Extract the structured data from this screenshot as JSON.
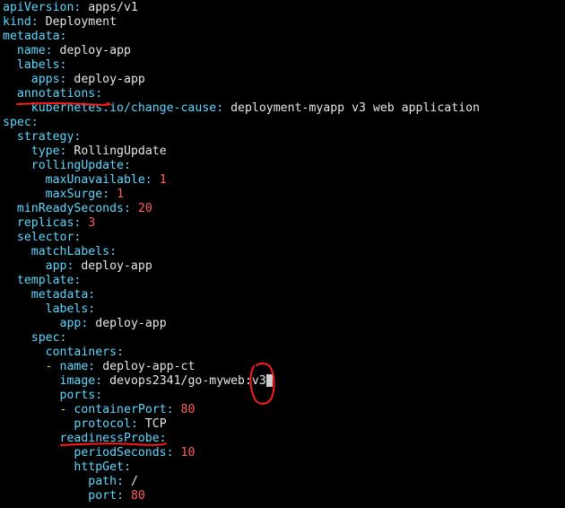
{
  "lines": [
    {
      "indent": "",
      "key": "apiVersion",
      "sep": ": ",
      "value": "apps/v1",
      "vtype": "s"
    },
    {
      "indent": "",
      "key": "kind",
      "sep": ": ",
      "value": "Deployment",
      "vtype": "s"
    },
    {
      "indent": "",
      "key": "metadata",
      "sep": ":",
      "value": "",
      "vtype": "s"
    },
    {
      "indent": "  ",
      "key": "name",
      "sep": ": ",
      "value": "deploy-app",
      "vtype": "s"
    },
    {
      "indent": "  ",
      "key": "labels",
      "sep": ":",
      "value": "",
      "vtype": "s"
    },
    {
      "indent": "    ",
      "key": "apps",
      "sep": ": ",
      "value": "deploy-app",
      "vtype": "s"
    },
    {
      "indent": "  ",
      "key": "annotations",
      "sep": ":",
      "value": "",
      "vtype": "s"
    },
    {
      "indent": "    ",
      "key": "kubernetes.io/change-cause",
      "sep": ": ",
      "value": "deployment-myapp v3 web application",
      "vtype": "s"
    },
    {
      "indent": "",
      "key": "spec",
      "sep": ":",
      "value": "",
      "vtype": "s"
    },
    {
      "indent": "  ",
      "key": "strategy",
      "sep": ":",
      "value": "",
      "vtype": "s"
    },
    {
      "indent": "    ",
      "key": "type",
      "sep": ": ",
      "value": "RollingUpdate",
      "vtype": "s"
    },
    {
      "indent": "    ",
      "key": "rollingUpdate",
      "sep": ":",
      "value": "",
      "vtype": "s"
    },
    {
      "indent": "      ",
      "key": "maxUnavailable",
      "sep": ": ",
      "value": "1",
      "vtype": "n"
    },
    {
      "indent": "      ",
      "key": "maxSurge",
      "sep": ": ",
      "value": "1",
      "vtype": "n"
    },
    {
      "indent": "  ",
      "key": "minReadySeconds",
      "sep": ": ",
      "value": "20",
      "vtype": "n"
    },
    {
      "indent": "  ",
      "key": "replicas",
      "sep": ": ",
      "value": "3",
      "vtype": "n"
    },
    {
      "indent": "  ",
      "key": "selector",
      "sep": ":",
      "value": "",
      "vtype": "s"
    },
    {
      "indent": "    ",
      "key": "matchLabels",
      "sep": ":",
      "value": "",
      "vtype": "s"
    },
    {
      "indent": "      ",
      "key": "app",
      "sep": ": ",
      "value": "deploy-app",
      "vtype": "s"
    },
    {
      "indent": "  ",
      "key": "template",
      "sep": ":",
      "value": "",
      "vtype": "s"
    },
    {
      "indent": "    ",
      "key": "metadata",
      "sep": ":",
      "value": "",
      "vtype": "s"
    },
    {
      "indent": "      ",
      "key": "labels",
      "sep": ":",
      "value": "",
      "vtype": "s"
    },
    {
      "indent": "        ",
      "key": "app",
      "sep": ": ",
      "value": "deploy-app",
      "vtype": "s"
    },
    {
      "indent": "    ",
      "key": "spec",
      "sep": ":",
      "value": "",
      "vtype": "s"
    },
    {
      "indent": "      ",
      "key": "containers",
      "sep": ":",
      "value": "",
      "vtype": "s"
    },
    {
      "indent": "      ",
      "dash": "- ",
      "key": "name",
      "sep": ": ",
      "value": "deploy-app-ct",
      "vtype": "s"
    },
    {
      "indent": "        ",
      "key": "image",
      "sep": ": ",
      "value": "devops2341/go-myweb:v3",
      "vtype": "s",
      "cursor": true
    },
    {
      "indent": "        ",
      "key": "ports",
      "sep": ":",
      "value": "",
      "vtype": "s"
    },
    {
      "indent": "        ",
      "dash": "- ",
      "key": "containerPort",
      "sep": ": ",
      "value": "80",
      "vtype": "n"
    },
    {
      "indent": "          ",
      "key": "protocol",
      "sep": ": ",
      "value": "TCP",
      "vtype": "s"
    },
    {
      "indent": "        ",
      "key": "readinessProbe",
      "sep": ":",
      "value": "",
      "vtype": "s"
    },
    {
      "indent": "          ",
      "key": "periodSeconds",
      "sep": ": ",
      "value": "10",
      "vtype": "n"
    },
    {
      "indent": "          ",
      "key": "httpGet",
      "sep": ":",
      "value": "",
      "vtype": "s"
    },
    {
      "indent": "            ",
      "key": "path",
      "sep": ": ",
      "value": "/",
      "vtype": "s"
    },
    {
      "indent": "            ",
      "key": "port",
      "sep": ": ",
      "value": "80",
      "vtype": "n"
    }
  ],
  "colors": {
    "background": "#000000",
    "key": "#5fd7ff",
    "string": "#e6e6e6",
    "number": "#ff5f5f",
    "dash": "#ffd700",
    "annotation_ink": "#ff1a1a"
  }
}
